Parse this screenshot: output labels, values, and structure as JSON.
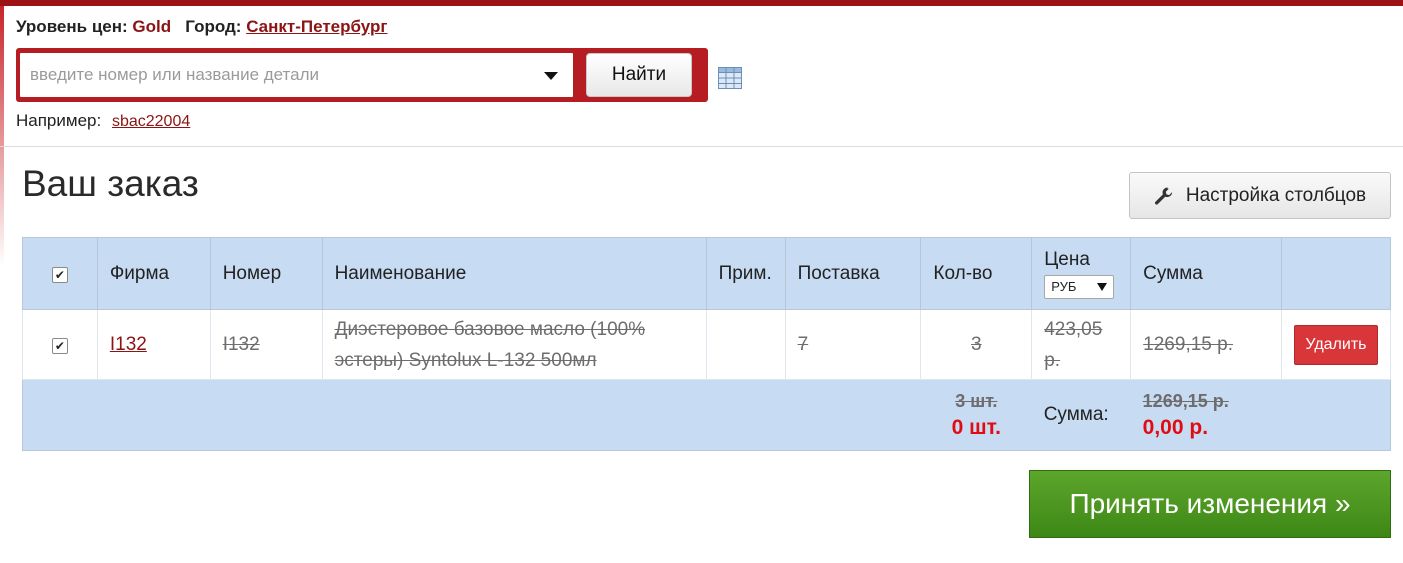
{
  "header": {
    "price_level_label": "Уровень цен:",
    "price_level_value": "Gold",
    "city_label": "Город:",
    "city_value": "Санкт-Петербург"
  },
  "search": {
    "placeholder": "введите номер или название детали",
    "button_label": "Найти",
    "example_label": "Например:",
    "example_value": "sbac22004"
  },
  "page": {
    "title": "Ваш заказ",
    "columns_button_label": "Настройка столбцов"
  },
  "table": {
    "headers": {
      "firm": "Фирма",
      "number": "Номер",
      "name": "Наименование",
      "note": "Прим.",
      "delivery": "Поставка",
      "qty": "Кол-во",
      "price": "Цена",
      "sum": "Сумма"
    },
    "currency": "РУБ",
    "rows": [
      {
        "checked": true,
        "firm": "I132",
        "number": "I132",
        "name": "Диэстеровое базовое масло (100% эстеры) Syntolux L-132 500мл",
        "note": "",
        "delivery": "7",
        "qty": "3",
        "price": "423,05 р.",
        "sum": "1269,15 р.",
        "delete_label": "Удалить"
      }
    ],
    "totals": {
      "old_qty": "3 шт.",
      "new_qty": "0 шт.",
      "sum_label": "Сумма:",
      "old_sum": "1269,15 р.",
      "new_sum": "0,00 р."
    }
  },
  "actions": {
    "accept_label": "Принять изменения »"
  },
  "colors": {
    "brand_red": "#b51d22",
    "header_blue": "#c7dbf2",
    "accept_green": "#4e9a22",
    "delete_red": "#d9363a"
  }
}
